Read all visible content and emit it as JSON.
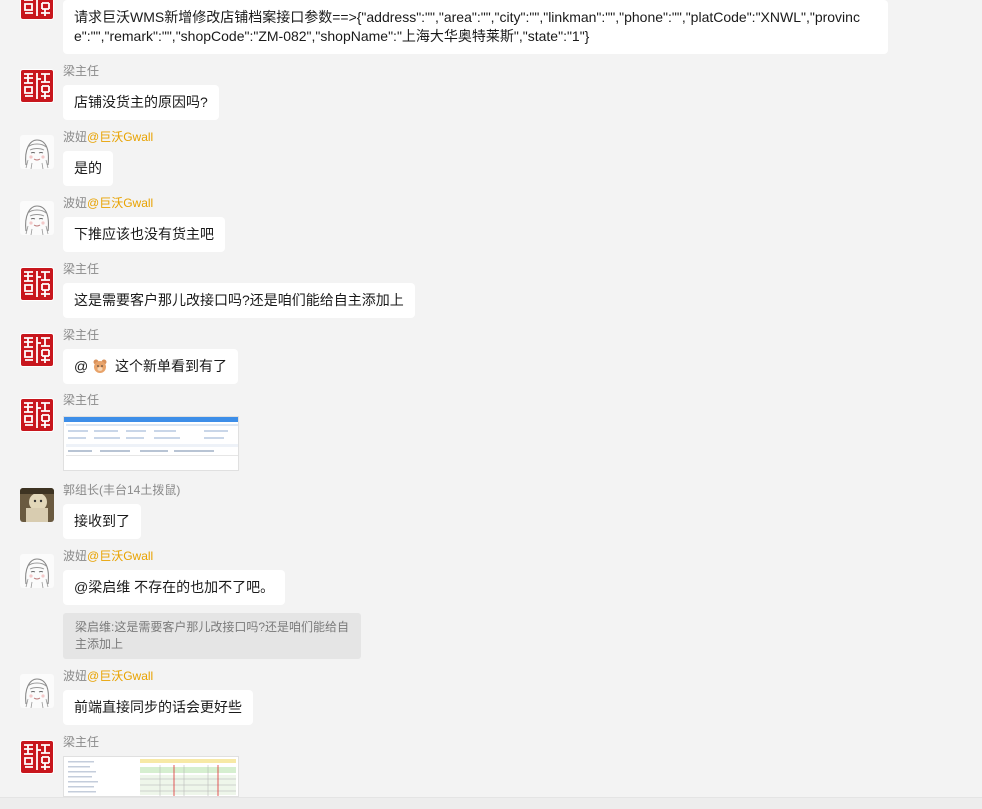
{
  "messages": [
    {
      "sender": "",
      "text": "请求巨沃WMS新增修改店铺档案接口参数==>{\"address\":\"\",\"area\":\"\",\"city\":\"\",\"linkman\":\"\",\"phone\":\"\",\"platCode\":\"XNWL\",\"province\":\"\",\"remark\":\"\",\"shopCode\":\"ZM-082\",\"shopName\":\"上海大华奥特莱斯\",\"state\":\"1\"}"
    },
    {
      "sender": "梁主任",
      "text": "店铺没货主的原因吗?"
    },
    {
      "sender": "波妞",
      "tag": "@巨沃Gwall",
      "text": "是的"
    },
    {
      "sender": "波妞",
      "tag": "@巨沃Gwall",
      "text": "下推应该也没有货主吧"
    },
    {
      "sender": "梁主任",
      "text": "这是需要客户那儿改接口吗?还是咱们能给自主添加上"
    },
    {
      "sender": "梁主任",
      "text_prefix": "@",
      "text": "这个新单看到有了"
    },
    {
      "sender": "梁主任",
      "image": "screenshot-image"
    },
    {
      "sender": "郭组长(丰台14土拨鼠)",
      "text": "接收到了"
    },
    {
      "sender": "波妞",
      "tag": "@巨沃Gwall",
      "text": "@梁启维 不存在的也加不了吧。",
      "quote": "梁启维:这是需要客户那儿改接口吗?还是咱们能给自主添加上"
    },
    {
      "sender": "波妞",
      "tag": "@巨沃Gwall",
      "text": "前端直接同步的话会更好些"
    },
    {
      "sender": "梁主任",
      "image": "screenshot-image"
    }
  ],
  "colors": {
    "background": "#f3f3f3",
    "bubble": "#ffffff",
    "sender": "#8a8a8a",
    "tag": "#e8a200",
    "quote_bg": "#e5e5e5"
  }
}
